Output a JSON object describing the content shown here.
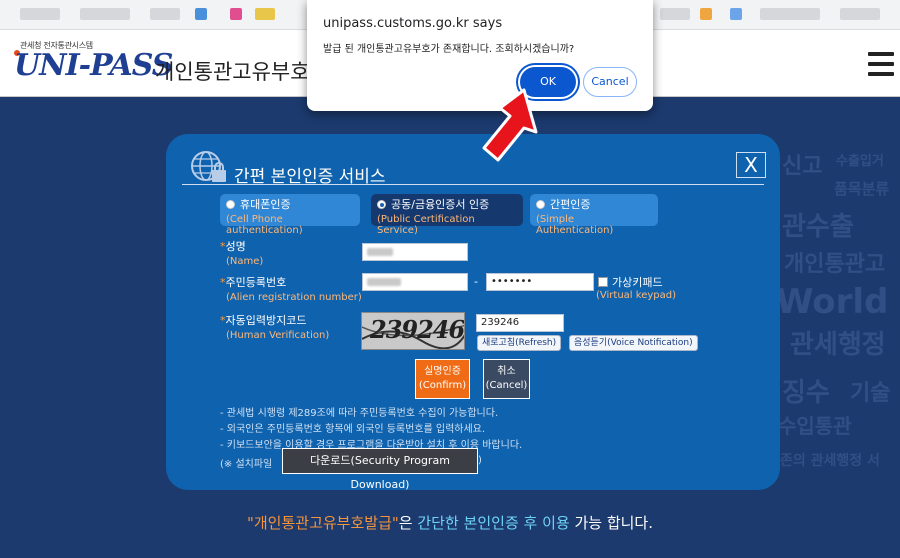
{
  "colors": {
    "background": "#1c3a6e",
    "panel": "#0f62ad",
    "accent_orange": "#f06b15",
    "dialog_primary": "#0b57d0",
    "arrow": "#e8141b"
  },
  "header": {
    "logo_subtitle": "관세청 전자통관시스템",
    "logo_text": "UNI-PASS",
    "site_title": "개인통관고유부호",
    "menu_icon": "hamburger-icon"
  },
  "background_words": [
    "신고",
    "수출입거",
    "품목분류",
    "관수출",
    "개인통관고",
    "World Be",
    "관세행정",
    "징수",
    "기술",
    "수입통관",
    "존의 관세행정 서"
  ],
  "panel": {
    "icon": "globe-lock-icon",
    "title": "간편 본인인증 서비스",
    "close_label": "X",
    "auth_tabs": [
      {
        "label": "휴대폰인증",
        "en": "(Cell Phone authentication)",
        "selected": false
      },
      {
        "label": "공동/금융인증서 인증",
        "en": "(Public Certification Service)",
        "selected": true
      },
      {
        "label": "간편인증",
        "en": "(Simple Authentication)",
        "selected": false
      }
    ],
    "fields": {
      "name": {
        "label": "성명",
        "en": "(Name)"
      },
      "reg_number": {
        "label": "주민등록번호",
        "en": "(Alien registration number)",
        "separator": "-",
        "second_value": "•••••••"
      },
      "virtual_keypad": {
        "label": "가상키패드",
        "en": "(Virtual keypad)"
      },
      "captcha": {
        "label": "자동입력방지코드",
        "en": "(Human Verification)",
        "image_text": "239246",
        "input_value": "239246",
        "refresh_label": "새로고침(Refresh)",
        "voice_label": "음성듣기(Voice Notification)"
      }
    },
    "confirm": {
      "line1": "실명인증",
      "line2": "(Confirm)"
    },
    "cancel": {
      "line1": "취소",
      "line2": "(Cancel)"
    },
    "notes": [
      "- 관세법 시행령 제289조에 따라 주민등록번호 수집이 가능합니다.",
      "- 외국인은 주민등록번호 항목에 외국인 등록번호를 입력하세요.",
      "- 키보드보안을 이용할 경우 프로그램을 다운받아 설치 후 이용 바랍니다."
    ],
    "install_prefix": "(※ 설치파일",
    "download_label": "다운로드(Security Program Download)",
    "install_suffix": ")"
  },
  "footer": {
    "part1": "\"개인통관고유부호발급\"",
    "part2": "은 ",
    "part3": "간단한 본인인증 후 이용",
    "part4": " 가능 합니다."
  },
  "dialog": {
    "title": "unipass.customs.go.kr says",
    "message": "발급 된 개인통관고유부호가 존재합니다. 조회하시겠습니까?",
    "ok_label": "OK",
    "cancel_label": "Cancel"
  }
}
